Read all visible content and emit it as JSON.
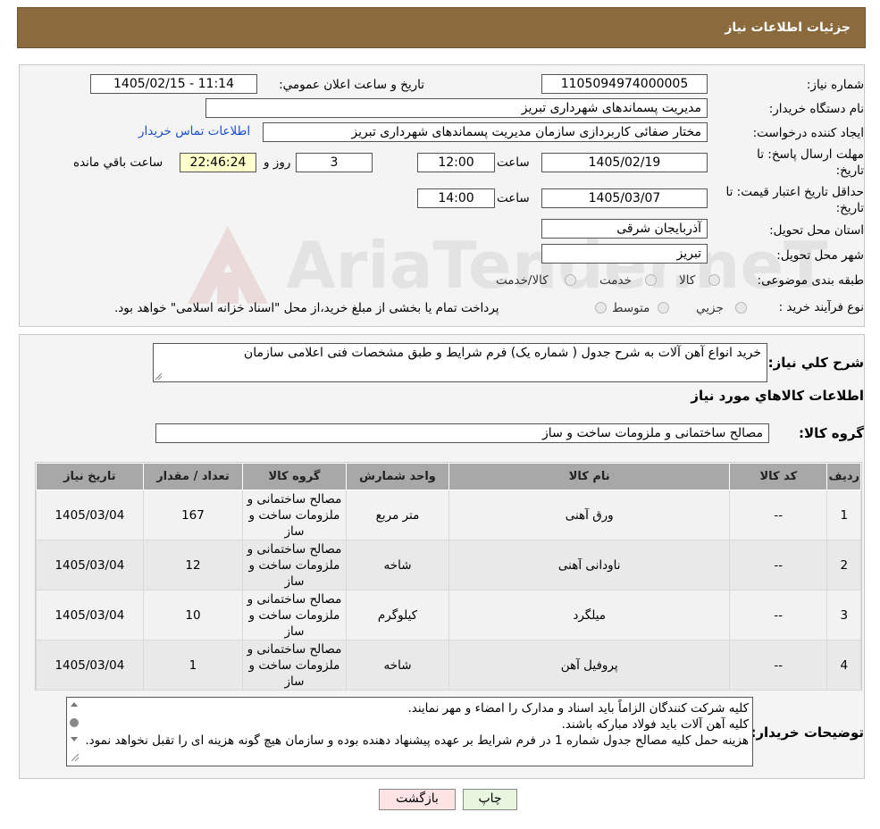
{
  "header": {
    "title": "جزئیات اطلاعات نیاز"
  },
  "watermark": {
    "text": "AriaTender.neT"
  },
  "info": {
    "need_number_label": "شماره نیاز:",
    "need_number": "1105094974000005",
    "announce_label": "تاریخ و ساعت اعلان عمومي:",
    "announce_value": "1405/02/15 - 11:14",
    "buyer_org_label": "نام دستگاه خريدار:",
    "buyer_org": "مدیریت پسماندهای شهرداری تبریز",
    "creator_label": "ايجاد کننده درخواست:",
    "creator": "مختار صفائی کاربردازی سازمان مدیریت پسماندهای شهرداری تبریز",
    "contact_link": "اطلاعات تماس خريدار",
    "deadline_label": "مهلت ارسال پاسخ: تا تاریخ:",
    "deadline_date": "1405/02/19",
    "time_label": "ساعت",
    "deadline_time": "12:00",
    "days_value": "3",
    "days_label": "روز و",
    "remaining_time": "22:46:24",
    "remaining_label": "ساعت باقي مانده",
    "validity_label": "حداقل تاریخ اعتبار قیمت: تا تاریخ:",
    "validity_date": "1405/03/07",
    "validity_time": "14:00",
    "province_label": "استان محل تحويل:",
    "province": "آذربایجان شرقی",
    "city_label": "شهر محل تحويل:",
    "city": "تبریز",
    "category_label": "طبقه بندی موضوعی:",
    "category_options": [
      "کالا",
      "خدمت",
      "کالا/خدمت"
    ],
    "process_label": "نوع فرآيند خريد :",
    "process_options": [
      "جزيي",
      "متوسط"
    ],
    "process_note": "پرداخت تمام یا بخشی از مبلغ خرید،از محل \"اسناد خزانه اسلامی\" خواهد بود."
  },
  "description": {
    "label": "شرح کلي نياز:",
    "value": "خرید انواع آهن آلات به شرح جدول ( شماره یک) فرم شرایط و طبق مشخصات فنی اعلامی سازمان"
  },
  "goods": {
    "section_title": "اطلاعات کالاهاي مورد نياز",
    "group_label": "گروه کالا:",
    "group_value": "مصالح ساختمانی و ملزومات ساخت و ساز",
    "headers": [
      "رديف",
      "کد کالا",
      "نام کالا",
      "واحد شمارش",
      "گروه کالا",
      "تعداد / مقدار",
      "تاریخ نیاز"
    ],
    "rows": [
      {
        "idx": "1",
        "code": "--",
        "name": "ورق آهنی",
        "unit": "متر مربع",
        "group": "مصالح ساختمانی و ملزومات ساخت و ساز",
        "qty": "167",
        "date": "1405/03/04"
      },
      {
        "idx": "2",
        "code": "--",
        "name": "ناودانی آهنی",
        "unit": "شاخه",
        "group": "مصالح ساختمانی و ملزومات ساخت و ساز",
        "qty": "12",
        "date": "1405/03/04"
      },
      {
        "idx": "3",
        "code": "--",
        "name": "میلگرد",
        "unit": "کیلوگرم",
        "group": "مصالح ساختمانی و ملزومات ساخت و ساز",
        "qty": "10",
        "date": "1405/03/04"
      },
      {
        "idx": "4",
        "code": "--",
        "name": "پروفیل آهن",
        "unit": "شاخه",
        "group": "مصالح ساختمانی و ملزومات ساخت و ساز",
        "qty": "1",
        "date": "1405/03/04"
      }
    ]
  },
  "buyer_notes": {
    "label": "توضيحات خريدار:",
    "lines": [
      "کلیه شرکت کنندگان الزاماً باید اسناد و مدارک را  امضاء و مهر نمایند.",
      "کلیه آهن آلات باید فولاد مبارکه باشند.",
      "هزینه حمل کلیه مصالح جدول شماره 1 در فرم شرایط بر عهده پیشنهاد دهنده بوده و سازمان هیچ گونه هزینه ای را تقبل نخواهد نمود."
    ]
  },
  "buttons": {
    "print": "چاپ",
    "back": "بازگشت"
  },
  "colors": {
    "header_bg": "#8b6a3e",
    "link": "#1a4fd1",
    "remaining_bg": "#ffffcc",
    "back_bg": "#fde3e3",
    "print_bg": "#e8f6e0"
  }
}
